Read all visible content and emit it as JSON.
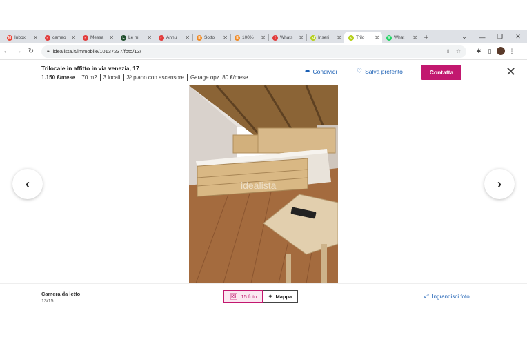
{
  "browser": {
    "tabs": [
      {
        "title": "Inbox",
        "favicon_color": "#ea4335",
        "favicon_glyph": "M"
      },
      {
        "title": "cameo",
        "favicon_color": "#e23b3b",
        "favicon_glyph": "✓"
      },
      {
        "title": "Messa",
        "favicon_color": "#e23b3b",
        "favicon_glyph": "✓"
      },
      {
        "title": "Le mi",
        "favicon_color": "#1e4d2b",
        "favicon_glyph": "L"
      },
      {
        "title": "Annu",
        "favicon_color": "#e23b3b",
        "favicon_glyph": "✓"
      },
      {
        "title": "Sotto",
        "favicon_color": "#f08a24",
        "favicon_glyph": "E"
      },
      {
        "title": "100%",
        "favicon_color": "#f08a24",
        "favicon_glyph": "E"
      },
      {
        "title": "Whats",
        "favicon_color": "#e23b3b",
        "favicon_glyph": "!"
      },
      {
        "title": "Inseri",
        "favicon_color": "#b7d11e",
        "favicon_glyph": "id"
      },
      {
        "title": "Trilo",
        "favicon_color": "#b7d11e",
        "favicon_glyph": "id",
        "active": true
      },
      {
        "title": "What",
        "favicon_color": "#25d366",
        "favicon_glyph": "W"
      }
    ],
    "url": "idealista.it/immobile/10137237/foto/13/"
  },
  "listing": {
    "title": "Trilocale in affitto in via venezia, 17",
    "price": "1.150 €/mese",
    "size": "70 m2",
    "rooms": "3 locali",
    "floor": "3º piano con ascensore",
    "garage": "Garage opz. 80 €/mese"
  },
  "actions": {
    "share": "Condividi",
    "save": "Salva preferito",
    "contact": "Contatta"
  },
  "gallery": {
    "caption": "Camera da letto",
    "counter": "13/15",
    "photos_label": "15 foto",
    "map_label": "Mappa",
    "enlarge_label": "Ingrandisci foto",
    "watermark": "idealista"
  },
  "colors": {
    "accent": "#c2186f",
    "link": "#1a5fb4"
  }
}
